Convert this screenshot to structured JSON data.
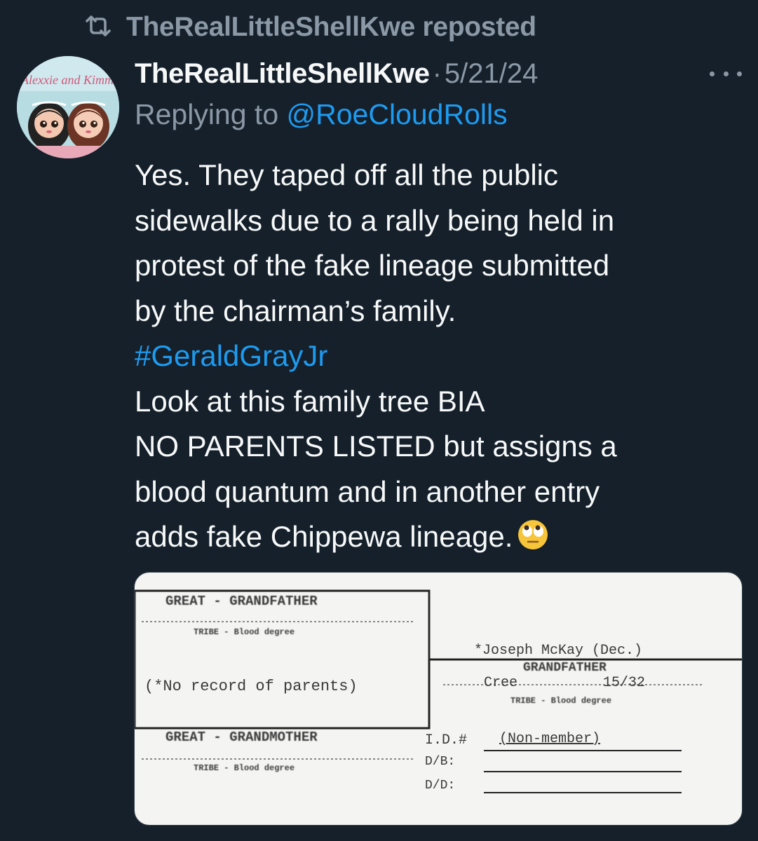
{
  "repost": {
    "icon": "repost-icon",
    "text": "TheRealLittleShellKwe reposted"
  },
  "author": {
    "display_name": "TheRealLittleShellKwe",
    "separator": "·",
    "timestamp": "5/21/24",
    "avatar_text": "Alexxie and Kimm"
  },
  "reply": {
    "prefix": "Replying to ",
    "handle": "@RoeCloudRolls"
  },
  "tweet": {
    "lines": [
      "Yes. They taped off all the public",
      "sidewalks due to a rally being held in",
      "protest of the fake lineage submitted",
      "by the chairman’s family."
    ],
    "hashtag": "#GeraldGrayJr",
    "lines2": [
      "Look at this family tree BIA",
      "NO PARENTS LISTED but assigns a",
      "blood quantum and in another entry",
      "adds fake Chippewa lineage."
    ],
    "emoji": "face-with-rolling-eyes-emoji"
  },
  "document": {
    "great_grandfather": "GREAT - GRANDFATHER",
    "tribe_blood_1": "TRIBE - Blood degree",
    "no_record": "(*No record of parents)",
    "great_grandmother": "GREAT - GRANDMOTHER",
    "tribe_blood_2": "TRIBE - Blood degree",
    "joseph": "*Joseph McKay (Dec.)",
    "grandfather": "GRANDFATHER",
    "cree": "Cree",
    "quantum": "15/32",
    "tribe_blood_3": "TRIBE - Blood degree",
    "id_label": "I.D.#",
    "id_value": "(Non-member)",
    "db_label": "D/B:",
    "dd_label": "D/D:"
  },
  "colors": {
    "background": "#15202b",
    "text": "#f7f9f9",
    "muted": "#8b98a5",
    "link": "#1d9bf0"
  }
}
